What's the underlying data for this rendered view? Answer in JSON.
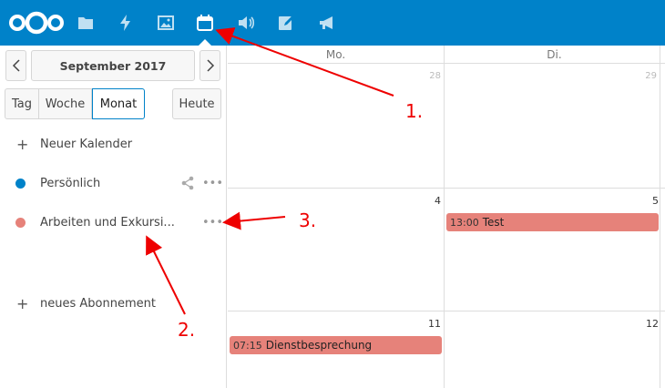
{
  "header": {
    "apps": [
      {
        "name": "files-icon"
      },
      {
        "name": "activity-icon"
      },
      {
        "name": "gallery-icon"
      },
      {
        "name": "calendar-icon",
        "active": true
      },
      {
        "name": "audio-icon"
      },
      {
        "name": "notes-icon"
      },
      {
        "name": "announcements-icon"
      }
    ],
    "bg_color": "#0082c9"
  },
  "sidebar": {
    "prev_label": "<",
    "month_label": "September 2017",
    "next_label": ">",
    "views": {
      "day": "Tag",
      "week": "Woche",
      "month": "Monat",
      "selected": "month"
    },
    "today_label": "Heute",
    "new_calendar_label": "Neuer Kalender",
    "calendars": [
      {
        "name": "Persönlich",
        "color": "#0082c9"
      },
      {
        "name": "Arbeiten und Exkursi...",
        "color": "#e6827a"
      }
    ],
    "new_subscription_label": "neues Abonnement"
  },
  "calendar": {
    "columns": [
      "Mo.",
      "Di."
    ],
    "weeks": [
      {
        "days": [
          "28",
          "29"
        ]
      },
      {
        "days": [
          "4",
          "5"
        ]
      },
      {
        "days": [
          "11",
          "12"
        ]
      }
    ],
    "events": [
      {
        "time": "13:00",
        "title": "Test",
        "color": "#e6827a"
      },
      {
        "time": "07:15",
        "title": "Dienstbesprechung",
        "color": "#e6827a"
      }
    ]
  },
  "annotations": {
    "labels": [
      "1.",
      "2.",
      "3."
    ],
    "color": "#e00000"
  }
}
